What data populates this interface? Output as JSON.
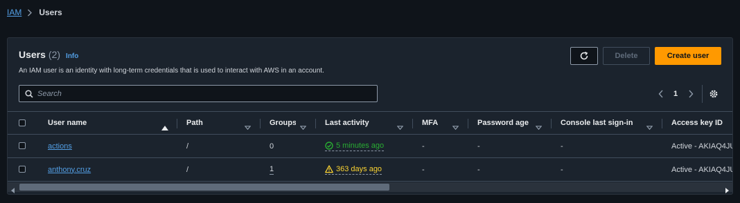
{
  "breadcrumb": {
    "root": "IAM",
    "current": "Users"
  },
  "panel": {
    "title": "Users",
    "count": "(2)",
    "info": "Info",
    "description": "An IAM user is an identity with long-term credentials that is used to interact with AWS in an account.",
    "delete_label": "Delete",
    "create_label": "Create user",
    "search_placeholder": "Search",
    "page_number": "1"
  },
  "columns": [
    "User name",
    "Path",
    "Groups",
    "Last activity",
    "MFA",
    "Password age",
    "Console last sign-in",
    "Access key ID"
  ],
  "rows": [
    {
      "user": "actions",
      "path": "/",
      "groups": "0",
      "last_activity": "5 minutes ago",
      "activity_status": "ok",
      "mfa": "-",
      "password_age": "-",
      "console": "-",
      "access_key": "Active - AKIAQ4JU"
    },
    {
      "user": "anthony.cruz",
      "path": "/",
      "groups": "1",
      "last_activity": "363 days ago",
      "activity_status": "warning",
      "mfa": "-",
      "password_age": "-",
      "console": "-",
      "access_key": "Active - AKIAQ4JU"
    }
  ],
  "colors": {
    "accent_orange": "#ff9900",
    "link_blue": "#539fe5",
    "success": "#29ad32",
    "warning": "#fbd332",
    "background": "#0f141a",
    "panel": "#1b232d"
  },
  "icons": [
    "chevron-right-icon",
    "refresh-icon",
    "search-icon",
    "chevron-left-icon",
    "settings-icon",
    "sort-up-icon",
    "sort-down-icon",
    "check-circle-icon",
    "warning-icon",
    "scroll-left-icon",
    "scroll-right-icon"
  ]
}
